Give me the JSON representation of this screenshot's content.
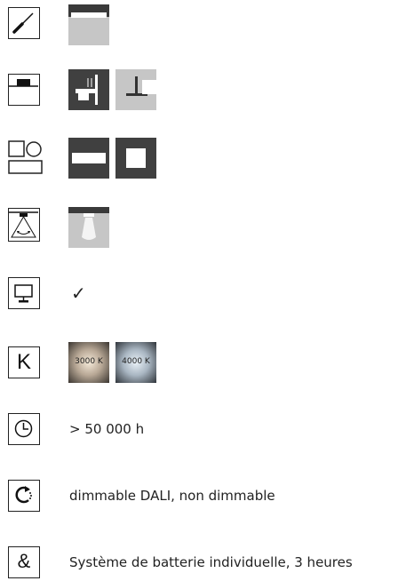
{
  "rows": [
    {
      "name": "mounting-tool",
      "icon": "screwdriver-icon"
    },
    {
      "name": "installation-type",
      "icon": "recessed-ceiling-icon"
    },
    {
      "name": "shape",
      "icon": "shapes-icon"
    },
    {
      "name": "light-distribution",
      "icon": "beam-angle-icon"
    },
    {
      "name": "control",
      "icon": "monitor-icon",
      "value": "✓"
    },
    {
      "name": "color-temperature",
      "icon": "kelvin-icon",
      "letter": "K",
      "options": [
        "3000 K",
        "4000 K"
      ]
    },
    {
      "name": "lifetime",
      "icon": "clock-icon",
      "value": "> 50 000 h"
    },
    {
      "name": "dimming",
      "icon": "dimming-icon",
      "value": "dimmable DALI, non dimmable"
    },
    {
      "name": "emergency",
      "icon": "ampersand-icon",
      "letter": "&",
      "value": "Système de batterie individuelle, 3 heures"
    }
  ]
}
